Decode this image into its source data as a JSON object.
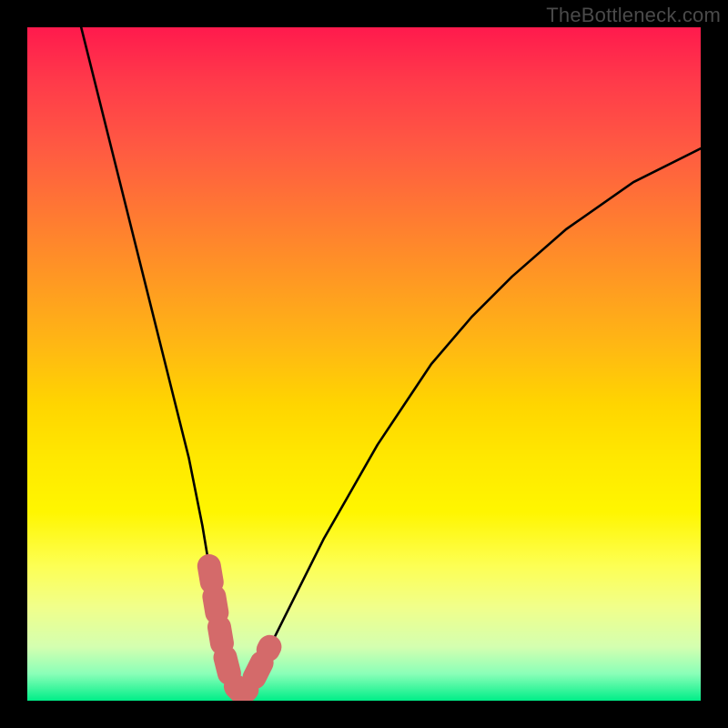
{
  "watermark": "TheBottleneck.com",
  "chart_data": {
    "type": "line",
    "title": "",
    "xlabel": "",
    "ylabel": "",
    "xlim": [
      0,
      100
    ],
    "ylim": [
      0,
      100
    ],
    "grid": false,
    "legend": false,
    "series": [
      {
        "name": "bottleneck-curve",
        "x": [
          8,
          10,
          12,
          14,
          16,
          18,
          20,
          22,
          24,
          26,
          27,
          28,
          29,
          30,
          31,
          32,
          33,
          34,
          36,
          38,
          40,
          44,
          48,
          52,
          56,
          60,
          66,
          72,
          80,
          90,
          100
        ],
        "values": [
          100,
          92,
          84,
          76,
          68,
          60,
          52,
          44,
          36,
          26,
          20,
          14,
          8,
          4,
          2,
          1,
          2,
          4,
          8,
          12,
          16,
          24,
          31,
          38,
          44,
          50,
          57,
          63,
          70,
          77,
          82
        ]
      }
    ],
    "marker": {
      "name": "selected-range",
      "points": [
        {
          "x": 27,
          "y": 20
        },
        {
          "x": 28,
          "y": 14
        },
        {
          "x": 29,
          "y": 8
        },
        {
          "x": 30,
          "y": 4
        },
        {
          "x": 31,
          "y": 2
        },
        {
          "x": 32,
          "y": 1
        },
        {
          "x": 33,
          "y": 2
        },
        {
          "x": 34,
          "y": 4
        },
        {
          "x": 36,
          "y": 8
        }
      ],
      "color": "#d46a6a",
      "width": 26
    },
    "colors": {
      "curve": "#000000",
      "gradient_top": "#ff1a4d",
      "gradient_mid": "#ffe800",
      "gradient_bottom": "#00ee88"
    }
  }
}
